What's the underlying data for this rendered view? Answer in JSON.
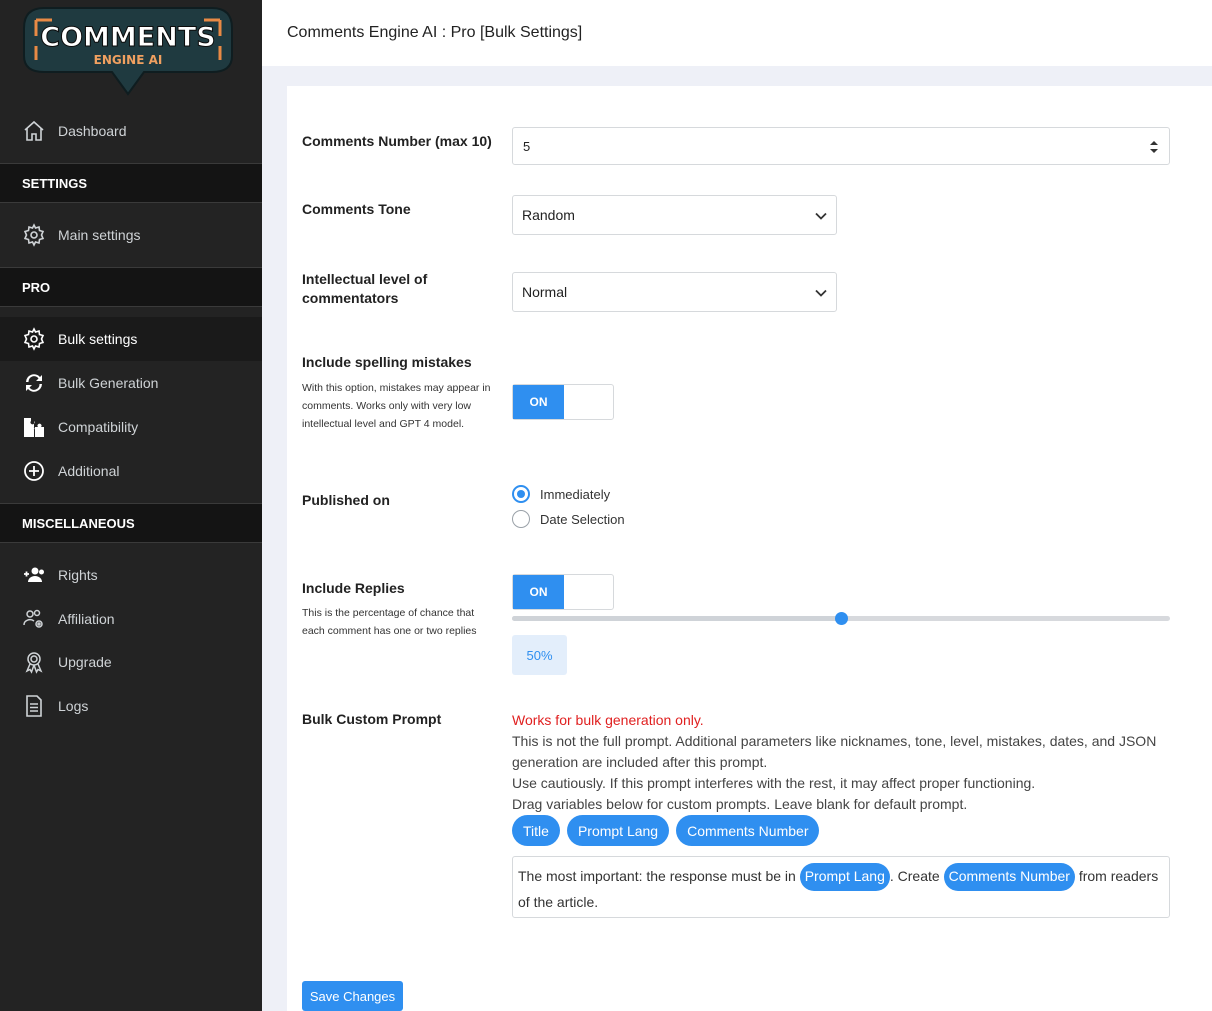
{
  "app": {
    "logo_main": "COMMENTS",
    "logo_sub": "ENGINE AI",
    "page_title": "Comments Engine AI : Pro [Bulk Settings]"
  },
  "sidebar": {
    "dashboard": "Dashboard",
    "section_settings": "SETTINGS",
    "main_settings": "Main settings",
    "section_pro": "PRO",
    "bulk_settings": "Bulk settings",
    "bulk_generation": "Bulk Generation",
    "compatibility": "Compatibility",
    "additional": "Additional",
    "section_misc": "MISCELLANEOUS",
    "rights": "Rights",
    "affiliation": "Affiliation",
    "upgrade": "Upgrade",
    "logs": "Logs",
    "active_item": "Bulk settings"
  },
  "form": {
    "comments_number": {
      "label": "Comments Number (max 10)",
      "value": "5"
    },
    "comments_tone": {
      "label": "Comments Tone",
      "value": "Random"
    },
    "intellectual_level": {
      "label": "Intellectual level of commentators",
      "value": "Normal"
    },
    "spelling": {
      "label": "Include spelling mistakes",
      "help": "With this option, mistakes may appear in comments. Works only with very low intellectual level and GPT 4 model.",
      "toggle": "ON"
    },
    "published_on": {
      "label": "Published on",
      "option_1": "Immediately",
      "option_2": "Date Selection",
      "selected": "Immediately"
    },
    "replies": {
      "label": "Include Replies",
      "help": "This is the percentage of chance that each comment has one or two replies",
      "toggle": "ON",
      "percent": 50,
      "percent_label": "50%"
    },
    "custom_prompt": {
      "label": "Bulk Custom Prompt",
      "warning": "Works for bulk generation only.",
      "line_1": "This is not the full prompt. Additional parameters like nicknames, tone, level, mistakes, dates, and JSON generation are included after this prompt.",
      "line_2": "Use cautiously. If this prompt interferes with the rest, it may affect proper functioning.",
      "line_3": "Drag variables below for custom prompts. Leave blank for default prompt.",
      "chip_1": "Title",
      "chip_2": "Prompt Lang",
      "chip_3": "Comments Number",
      "text_a": "The most important: the response must be in ",
      "var_a": "Prompt Lang",
      "text_b": ". Create ",
      "var_b": "Comments Number",
      "text_c": " from readers of the article."
    },
    "save_label": "Save Changes"
  },
  "colors": {
    "accent": "#2f8ff0",
    "sidebar_bg": "#232323",
    "warning": "#e02020"
  }
}
